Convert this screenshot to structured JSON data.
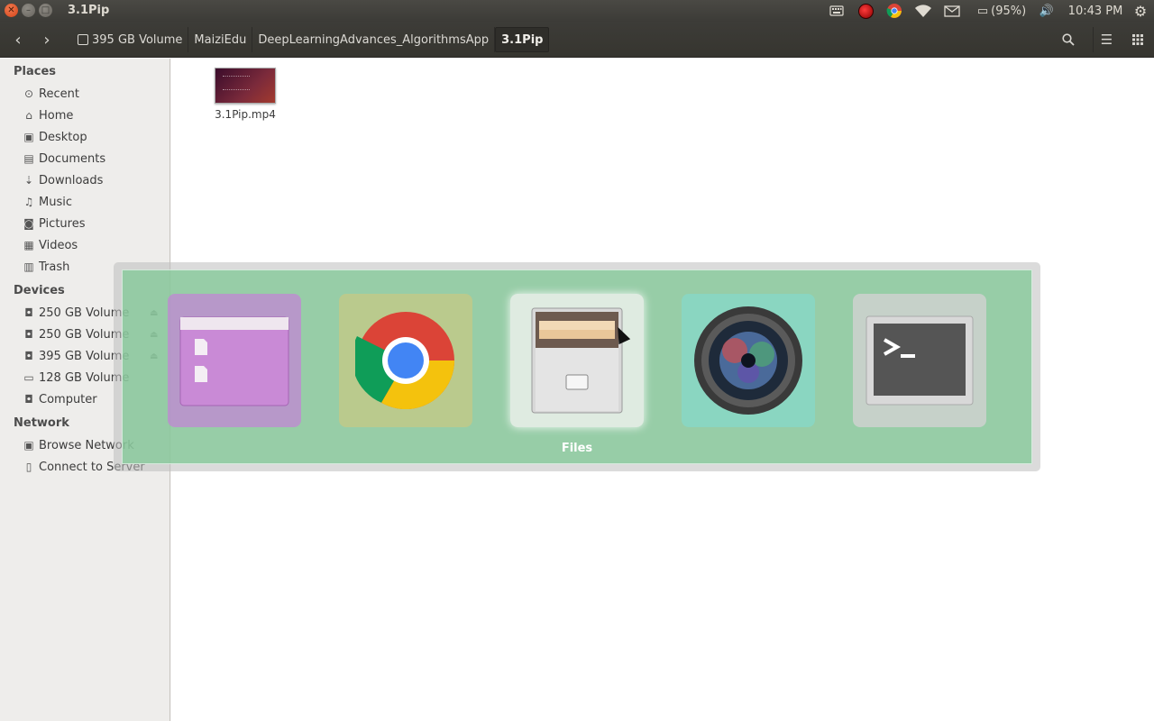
{
  "window": {
    "title": "3.1Pip",
    "close_glyph": "✕",
    "minimize_glyph": "–",
    "maximize_glyph": "□"
  },
  "tray": {
    "keyboard_icon": "keyboard-icon",
    "record_icon": "record-icon",
    "chrome_icon": "chrome-icon",
    "wifi_icon": "wifi-icon",
    "mail_icon": "mail-icon",
    "battery": "(95%)",
    "battery_glyph": "▭",
    "volume_glyph": "🔊",
    "clock": "10:43 PM",
    "gear_glyph": "⚙"
  },
  "header": {
    "back_glyph": "‹",
    "forward_glyph": "›",
    "breadcrumbs": [
      "395 GB Volume",
      "MaiziEdu",
      "DeepLearningAdvances_AlgorithmsApp",
      "3.1Pip"
    ],
    "search_glyph": "⌕",
    "menu_glyph": "☰",
    "grid_glyph": "⋮⋮⋮"
  },
  "sidebar": {
    "places_title": "Places",
    "places": [
      {
        "label": "Recent",
        "icon": "⊙"
      },
      {
        "label": "Home",
        "icon": "⌂"
      },
      {
        "label": "Desktop",
        "icon": "▣"
      },
      {
        "label": "Documents",
        "icon": "▤"
      },
      {
        "label": "Downloads",
        "icon": "⇣"
      },
      {
        "label": "Music",
        "icon": "♫"
      },
      {
        "label": "Pictures",
        "icon": "◙"
      },
      {
        "label": "Videos",
        "icon": "▦"
      },
      {
        "label": "Trash",
        "icon": "▥"
      }
    ],
    "devices_title": "Devices",
    "devices": [
      {
        "label": "250 GB Volume",
        "icon": "◘",
        "eject": "⏏"
      },
      {
        "label": "250 GB Volume",
        "icon": "◘",
        "eject": "⏏"
      },
      {
        "label": "395 GB Volume",
        "icon": "◘",
        "eject": "⏏"
      },
      {
        "label": "128 GB Volume",
        "icon": "▭",
        "eject": ""
      },
      {
        "label": "Computer",
        "icon": "◘",
        "eject": ""
      }
    ],
    "network_title": "Network",
    "network": [
      {
        "label": "Browse Network",
        "icon": "▣"
      },
      {
        "label": "Connect to Server",
        "icon": "▯"
      }
    ]
  },
  "content": {
    "files": [
      {
        "name": "3.1Pip.mp4"
      }
    ]
  },
  "switcher": {
    "apps": [
      {
        "name": "files-manager",
        "icon": "folder-icon"
      },
      {
        "name": "chrome",
        "icon": "chrome-icon"
      },
      {
        "name": "files",
        "icon": "file-cabinet-icon"
      },
      {
        "name": "camera",
        "icon": "camera-lens-icon"
      },
      {
        "name": "terminal",
        "icon": "terminal-icon"
      }
    ],
    "selected_label": "Files",
    "terminal_prompt": ">_"
  }
}
